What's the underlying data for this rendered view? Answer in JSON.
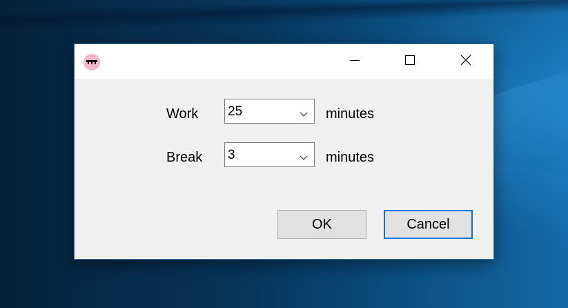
{
  "dialog": {
    "title_icon": "pomodoro-tomato-icon",
    "controls": {
      "minimize_icon": "minimize-icon",
      "maximize_icon": "maximize-icon",
      "close_icon": "close-icon"
    }
  },
  "form": {
    "work": {
      "label": "Work",
      "value": "25",
      "unit": "minutes"
    },
    "break": {
      "label": "Break",
      "value": "3",
      "unit": "minutes"
    }
  },
  "buttons": {
    "ok_label": "OK",
    "cancel_label": "Cancel"
  },
  "colors": {
    "focus_accent": "#0078d7",
    "dialog_bg": "#f0f0f0",
    "titlebar_bg": "#ffffff"
  }
}
